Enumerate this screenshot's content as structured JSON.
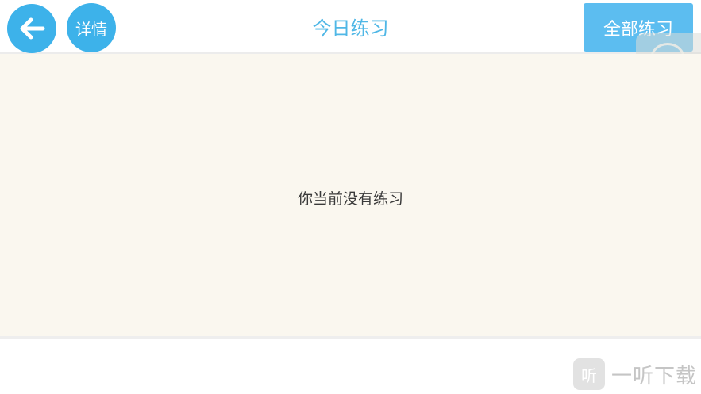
{
  "header": {
    "back_icon": "arrow-left-icon",
    "detail_label": "详情",
    "title": "今日练习",
    "all_practice_label": "全部练习"
  },
  "content": {
    "empty_message": "你当前没有练习"
  },
  "watermark": {
    "logo_glyph": "听",
    "text": "一听下载"
  },
  "colors": {
    "accent": "#3db2ea",
    "title": "#4fb7e6",
    "content_bg": "#faf7ef"
  }
}
